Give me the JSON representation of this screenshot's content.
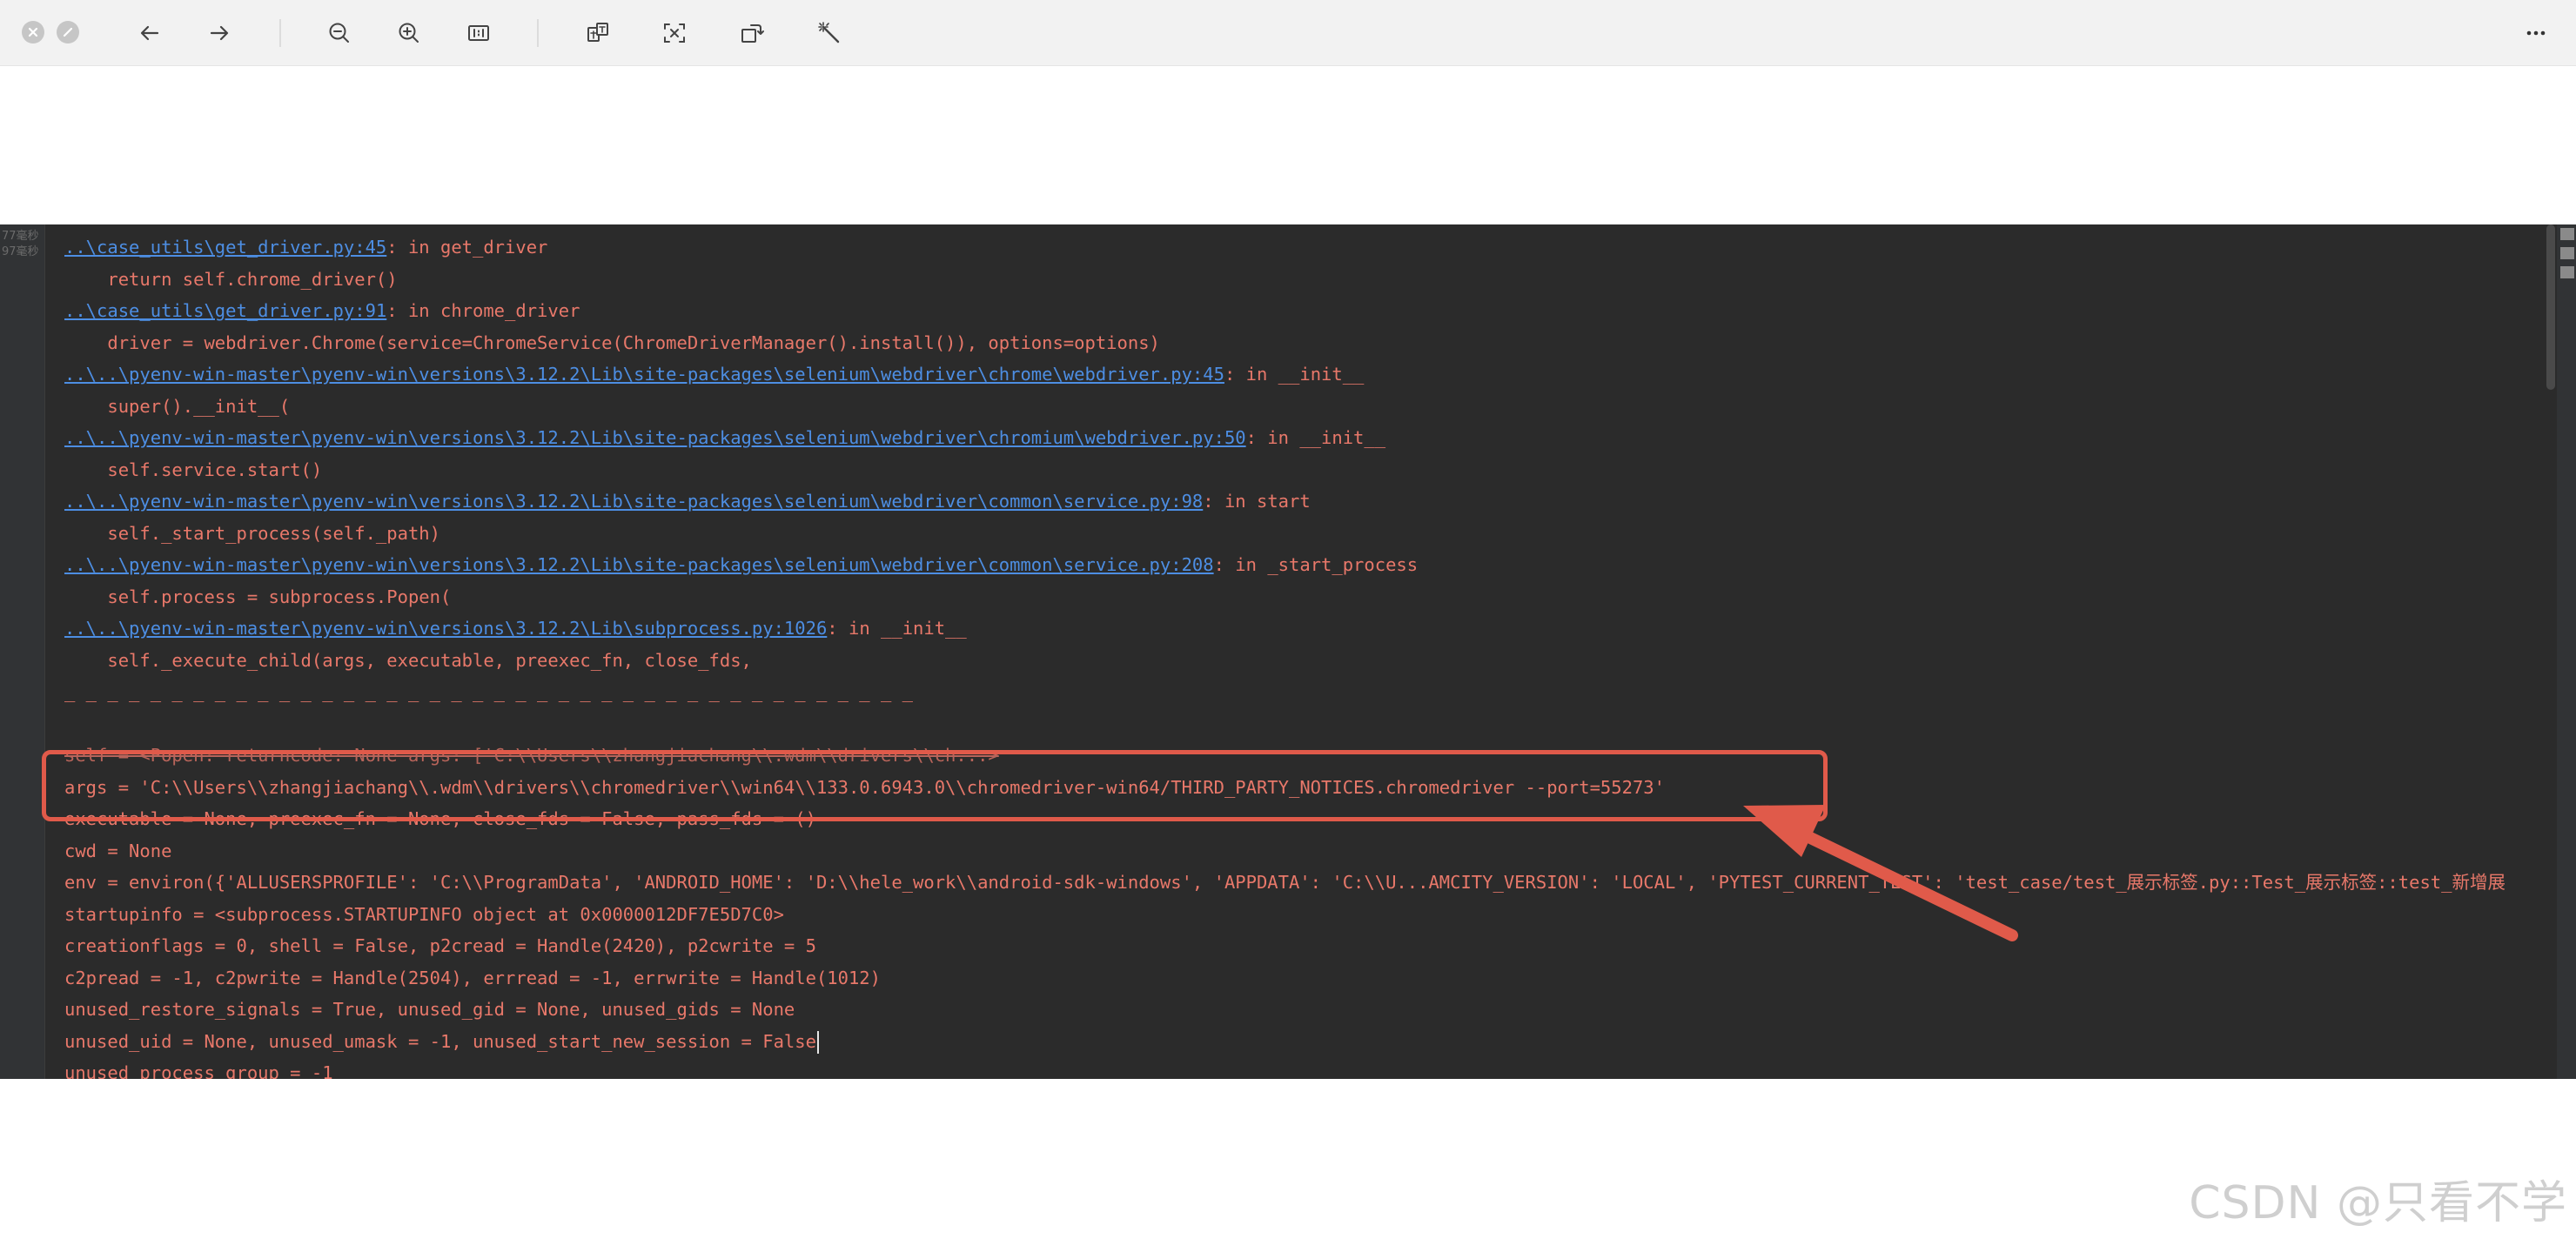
{
  "toolbar": {
    "buttons": [
      {
        "id": "close",
        "icon": "close-icon"
      },
      {
        "id": "minimize",
        "icon": "minimize-icon"
      },
      {
        "id": "back",
        "icon": "arrow-left-icon"
      },
      {
        "id": "forward",
        "icon": "arrow-right-icon"
      },
      {
        "id": "zoom-out",
        "icon": "zoom-out-icon"
      },
      {
        "id": "zoom-in",
        "icon": "zoom-in-icon"
      },
      {
        "id": "actual-size",
        "icon": "actual-size-icon"
      },
      {
        "id": "translate",
        "icon": "translate-icon"
      },
      {
        "id": "extract-text",
        "icon": "extract-text-icon"
      },
      {
        "id": "rotate",
        "icon": "rotate-icon"
      },
      {
        "id": "enhance",
        "icon": "magic-wand-icon"
      },
      {
        "id": "more",
        "icon": "more-icon"
      }
    ]
  },
  "gutter": {
    "line1": "77毫秒",
    "line2": "97毫秒"
  },
  "console": {
    "lines": [
      {
        "link": "..\\case_utils\\get_driver.py:45",
        "text": ": in get_driver"
      },
      {
        "text": "    return self.chrome_driver()"
      },
      {
        "link": "..\\case_utils\\get_driver.py:91",
        "text": ": in chrome_driver"
      },
      {
        "text": "    driver = webdriver.Chrome(service=ChromeService(ChromeDriverManager().install()), options=options)"
      },
      {
        "link": "..\\..\\pyenv-win-master\\pyenv-win\\versions\\3.12.2\\Lib\\site-packages\\selenium\\webdriver\\chrome\\webdriver.py:45",
        "text": ": in __init__"
      },
      {
        "text": "    super().__init__("
      },
      {
        "link": "..\\..\\pyenv-win-master\\pyenv-win\\versions\\3.12.2\\Lib\\site-packages\\selenium\\webdriver\\chromium\\webdriver.py:50",
        "text": ": in __init__"
      },
      {
        "text": "    self.service.start()"
      },
      {
        "link": "..\\..\\pyenv-win-master\\pyenv-win\\versions\\3.12.2\\Lib\\site-packages\\selenium\\webdriver\\common\\service.py:98",
        "text": ": in start"
      },
      {
        "text": "    self._start_process(self._path)"
      },
      {
        "link": "..\\..\\pyenv-win-master\\pyenv-win\\versions\\3.12.2\\Lib\\site-packages\\selenium\\webdriver\\common\\service.py:208",
        "text": ": in _start_process"
      },
      {
        "text": "    self.process = subprocess.Popen("
      },
      {
        "link": "..\\..\\pyenv-win-master\\pyenv-win\\versions\\3.12.2\\Lib\\subprocess.py:1026",
        "text": ": in __init__"
      },
      {
        "text": "    self._execute_child(args, executable, preexec_fn, close_fds,"
      },
      {
        "text": "_ _ _ _ _ _ _ _ _ _ _ _ _ _ _ _ _ _ _ _ _ _ _ _ _ _ _ _ _ _ _ _ _ _ _ _ _ _ _ _"
      },
      {
        "text": ""
      },
      {
        "text": "self = <Popen: returncode: None args: ['C:\\\\Users\\\\zhangjiachang\\\\.wdm\\\\drivers\\\\ch...>",
        "struck": true
      },
      {
        "text": "args = 'C:\\\\Users\\\\zhangjiachang\\\\.wdm\\\\drivers\\\\chromedriver\\\\win64\\\\133.0.6943.0\\\\chromedriver-win64/THIRD_PARTY_NOTICES.chromedriver --port=55273'"
      },
      {
        "text": "executable = None, preexec_fn = None, close_fds = False, pass_fds = ()"
      },
      {
        "text": "cwd = None"
      },
      {
        "text": "env = environ({'ALLUSERSPROFILE': 'C:\\\\ProgramData', 'ANDROID_HOME': 'D:\\\\hele_work\\\\android-sdk-windows', 'APPDATA': 'C:\\\\U...AMCITY_VERSION': 'LOCAL', 'PYTEST_CURRENT_TEST': 'test_case/test_展示标签.py::Test_展示标签::test_新增展"
      },
      {
        "text": "startupinfo = <subprocess.STARTUPINFO object at 0x0000012DF7E5D7C0>"
      },
      {
        "text": "creationflags = 0, shell = False, p2cread = Handle(2420), p2cwrite = 5"
      },
      {
        "text": "c2pread = -1, c2pwrite = Handle(2504), errread = -1, errwrite = Handle(1012)"
      },
      {
        "text": "unused_restore_signals = True, unused_gid = None, unused_gids = None"
      },
      {
        "text": "unused_uid = None, unused_umask = -1, unused_start_new_session = False",
        "caret": true
      },
      {
        "text": "unused_process_group = -1"
      }
    ]
  },
  "annotation": {
    "box_color": "#e05a4a",
    "arrow_color": "#e05a4a"
  },
  "watermark": "CSDN @只看不学"
}
